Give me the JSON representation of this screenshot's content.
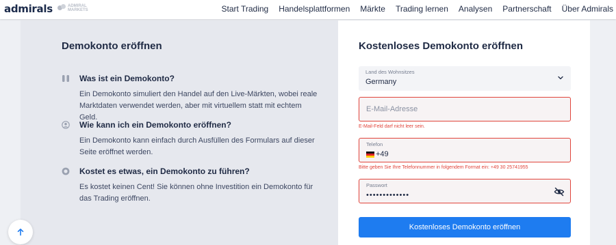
{
  "brand": {
    "logo": "admirals",
    "sub_logo": "ADMIRAL MARKETS"
  },
  "nav": {
    "items": [
      "Start Trading",
      "Handelsplattformen",
      "Märkte",
      "Trading lernen",
      "Analysen",
      "Partnerschaft",
      "Über Admirals"
    ]
  },
  "info": {
    "title": "Demokonto eröffnen",
    "faqs": [
      {
        "icon": "hourglass-icon",
        "question": "Was ist ein Demokonto?",
        "answer": "Ein Demokonto simuliert den Handel auf den Live-Märkten, wobei reale Marktdaten verwendet werden, aber mit virtuellem statt mit echtem Geld."
      },
      {
        "icon": "user-circle-icon",
        "question": "Wie kann ich ein Demokonto eröffnen?",
        "answer": "Ein Demokonto kann einfach durch Ausfüllen des Formulars auf dieser Seite eröffnet werden."
      },
      {
        "icon": "coin-icon",
        "question": "Kostet es etwas, ein Demokonto zu führen?",
        "answer": "Es kostet keinen Cent! Sie können ohne Investition ein Demokonto für das Trading eröffnen."
      }
    ]
  },
  "form": {
    "title": "Kostenloses Demokonto eröffnen",
    "country": {
      "label": "Land des Wohnsitzes",
      "value": "Germany"
    },
    "email": {
      "placeholder": "E-Mail-Adresse",
      "value": "",
      "error": "E-Mail-Feld darf nicht leer sein."
    },
    "phone": {
      "label": "Telefon",
      "country_code": "+49",
      "flag": "germany-flag-icon",
      "error": "Bitte geben Sie Ihre Telefonnummer in folgendem Format ein: +49 30 25741955"
    },
    "password": {
      "label": "Passwort",
      "masked_value": "•••••••••••••"
    },
    "submit_label": "Kostenloses Demokonto eröffnen"
  },
  "colors": {
    "accent": "#1e7cf0",
    "error": "#e0433a",
    "text": "#1f2a44"
  }
}
